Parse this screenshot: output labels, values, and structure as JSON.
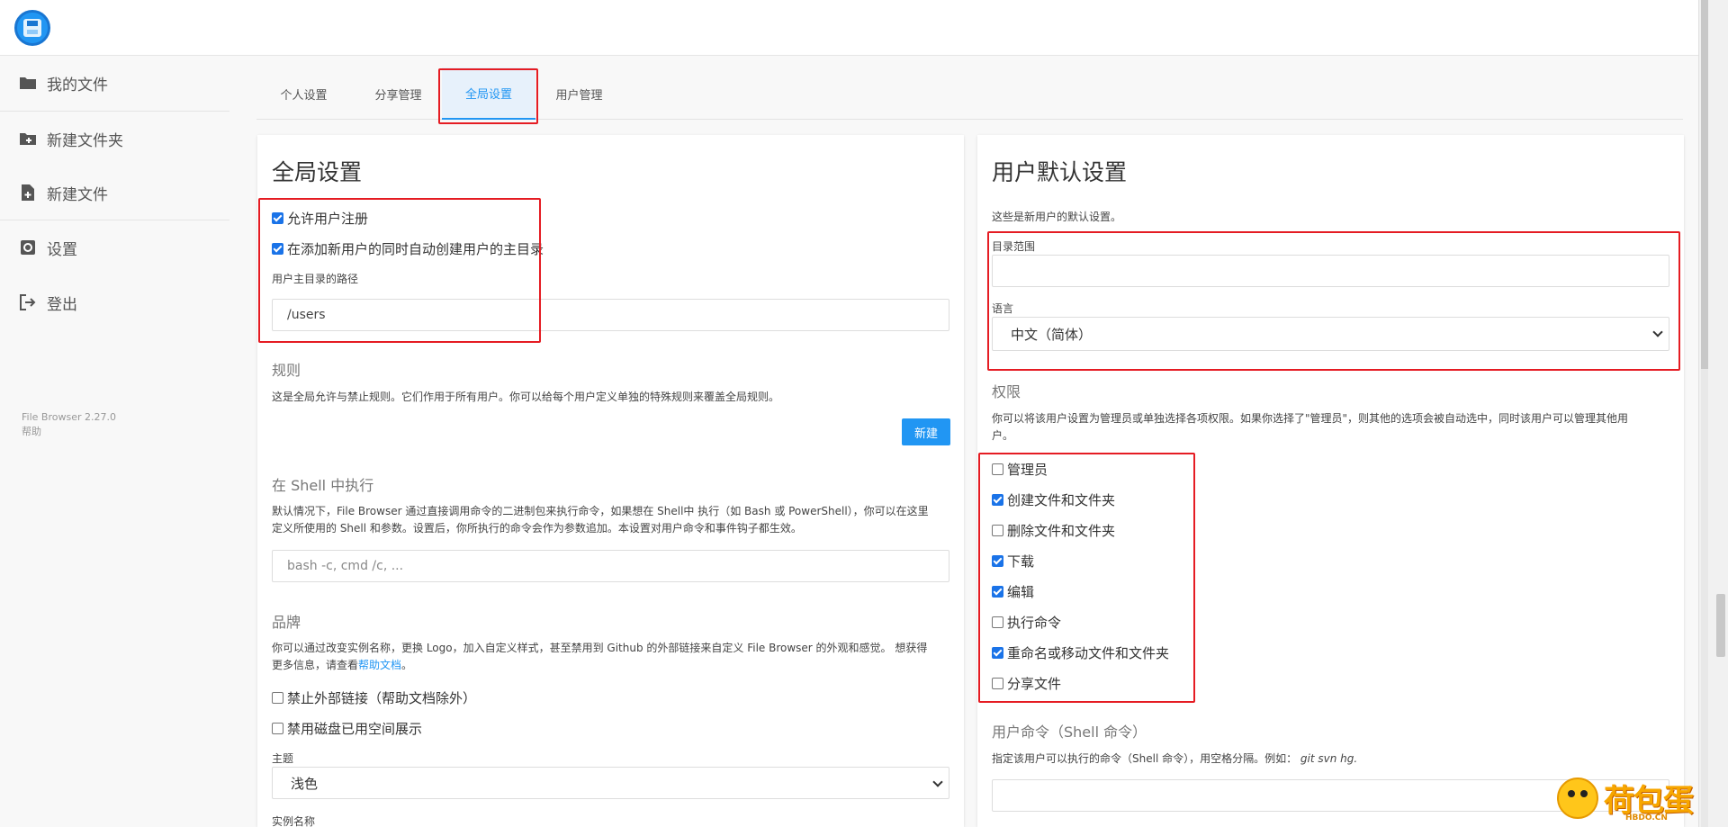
{
  "sidebar": {
    "items": [
      {
        "label": "我的文件",
        "icon": "folder-icon"
      },
      {
        "label": "新建文件夹",
        "icon": "new-folder-icon"
      },
      {
        "label": "新建文件",
        "icon": "new-file-icon"
      },
      {
        "label": "设置",
        "icon": "settings-icon"
      },
      {
        "label": "登出",
        "icon": "logout-icon"
      }
    ],
    "version": "File Browser 2.27.0",
    "help": "帮助"
  },
  "tabs": [
    "个人设置",
    "分享管理",
    "全局设置",
    "用户管理"
  ],
  "active_tab": "全局设置",
  "global": {
    "title": "全局设置",
    "allow_signup": {
      "label": "允许用户注册",
      "checked": true
    },
    "create_home": {
      "label": "在添加新用户的同时自动创建用户的主目录",
      "checked": true
    },
    "home_path_label": "用户主目录的路径",
    "home_path_value": "/users",
    "rules_title": "规则",
    "rules_desc": "这是全局允许与禁止规则。它们作用于所有用户。你可以给每个用户定义单独的特殊规则来覆盖全局规则。",
    "new_button": "新建",
    "shell_title": "在 Shell 中执行",
    "shell_desc_1": "默认情况下，File Browser 通过直接调用命令的二进制包来执行命令，如果想在 Shell中 执行（如 Bash 或 PowerShell），你可以在这里",
    "shell_desc_2": "定义所使用的 Shell 和参数。设置后，你所执行的命令会作为参数追加。本设置对用户命令和事件钩子都生效。",
    "shell_placeholder": "bash -c, cmd /c, ...",
    "branding_title": "品牌",
    "branding_desc_1": "你可以通过改变实例名称，更换 Logo，加入自定义样式，甚至禁用到 Github 的外部链接来自定义 File Browser 的外观和感觉。 想获得",
    "branding_desc_2": "更多信息，请查看",
    "branding_link": "帮助文档",
    "branding_desc_end": "。",
    "disable_external": {
      "label": "禁止外部链接（帮助文档除外）",
      "checked": false
    },
    "disable_disk": {
      "label": "禁用磁盘已用空间展示",
      "checked": false
    },
    "theme_label": "主题",
    "theme_value": "浅色",
    "instance_label": "实例名称"
  },
  "defaults": {
    "title": "用户默认设置",
    "desc": "这些是新用户的默认设置。",
    "scope_label": "目录范围",
    "scope_value": "",
    "language_label": "语言",
    "language_value": "中文（简体）",
    "perm_title": "权限",
    "perm_desc_1": "你可以将该用户设置为管理员或单独选择各项权限。如果你选择了\"管理员\"，则其他的选项会被自动选中，同时该用户可以管理其他用",
    "perm_desc_2": "户。",
    "perms": [
      {
        "label": "管理员",
        "checked": false
      },
      {
        "label": "创建文件和文件夹",
        "checked": true
      },
      {
        "label": "删除文件和文件夹",
        "checked": false
      },
      {
        "label": "下载",
        "checked": true
      },
      {
        "label": "编辑",
        "checked": true
      },
      {
        "label": "执行命令",
        "checked": false
      },
      {
        "label": "重命名或移动文件和文件夹",
        "checked": true
      },
      {
        "label": "分享文件",
        "checked": false
      }
    ],
    "cmd_title": "用户命令（Shell 命令）",
    "cmd_desc": "指定该用户可以执行的命令（Shell 命令），用空格分隔。例如：",
    "cmd_example": "git svn hg."
  },
  "watermark": {
    "text": "荷包蛋",
    "sub": "HBDO.CN"
  },
  "colors": {
    "accent": "#2196f3",
    "highlight": "#e51c23"
  }
}
